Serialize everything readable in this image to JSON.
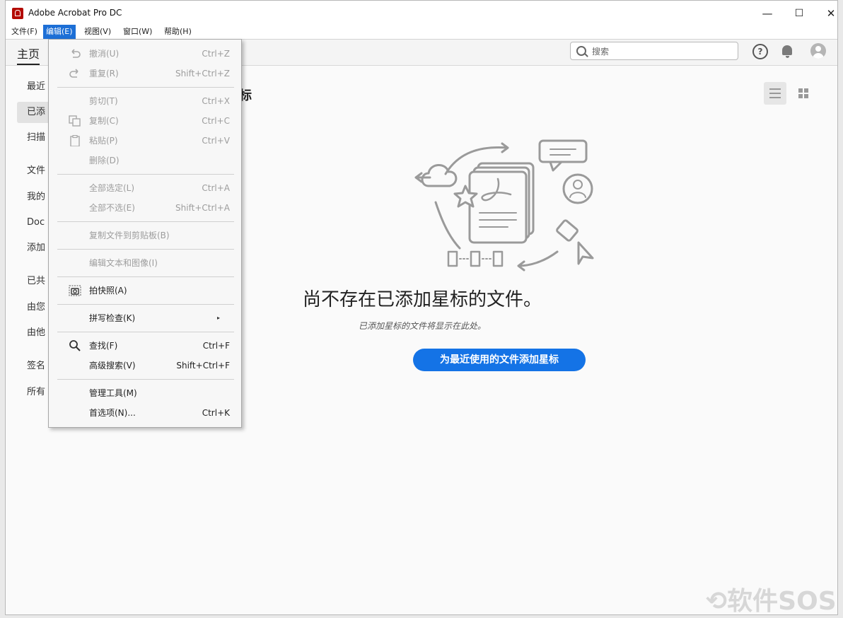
{
  "app": {
    "title": "Adobe Acrobat Pro DC"
  },
  "window_controls": {
    "minimize": "—",
    "maximize": "☐",
    "close": "✕"
  },
  "menubar": [
    {
      "label": "文件(F)"
    },
    {
      "label": "编辑(E)"
    },
    {
      "label": "视图(V)"
    },
    {
      "label": "窗口(W)"
    },
    {
      "label": "帮助(H)"
    }
  ],
  "tabbar": {
    "home_label": "主页",
    "search_placeholder": "搜索",
    "help_glyph": "?"
  },
  "sidebar": {
    "items": [
      {
        "label": "最近"
      },
      {
        "label": "已添"
      },
      {
        "label": "扫描"
      },
      {
        "label": "文件"
      },
      {
        "label": "我的"
      },
      {
        "label": "Doc"
      },
      {
        "label": "添加"
      },
      {
        "label": "已共"
      },
      {
        "label": "由您"
      },
      {
        "label": "由他"
      },
      {
        "label": "签名"
      },
      {
        "label": "所有"
      }
    ]
  },
  "main": {
    "section_title_visible": "标",
    "empty_title": "尚不存在已添加星标的文件。",
    "empty_subtitle": "已添加星标的文件将显示在此处。",
    "cta_label": "为最近使用的文件添加星标"
  },
  "edit_menu": {
    "items": [
      {
        "label": "撤消(U)",
        "shortcut": "Ctrl+Z"
      },
      {
        "label": "重复(R)",
        "shortcut": "Shift+Ctrl+Z"
      },
      {
        "label": "剪切(T)",
        "shortcut": "Ctrl+X"
      },
      {
        "label": "复制(C)",
        "shortcut": "Ctrl+C"
      },
      {
        "label": "粘贴(P)",
        "shortcut": "Ctrl+V"
      },
      {
        "label": "删除(D)",
        "shortcut": ""
      },
      {
        "label": "全部选定(L)",
        "shortcut": "Ctrl+A"
      },
      {
        "label": "全部不选(E)",
        "shortcut": "Shift+Ctrl+A"
      },
      {
        "label": "复制文件到剪贴板(B)",
        "shortcut": ""
      },
      {
        "label": "编辑文本和图像(I)",
        "shortcut": ""
      },
      {
        "label": "拍快照(A)",
        "shortcut": ""
      },
      {
        "label": "拼写检查(K)",
        "shortcut": ""
      },
      {
        "label": "查找(F)",
        "shortcut": "Ctrl+F"
      },
      {
        "label": "高级搜索(V)",
        "shortcut": "Shift+Ctrl+F"
      },
      {
        "label": "管理工具(M)",
        "shortcut": ""
      },
      {
        "label": "首选项(N)...",
        "shortcut": "Ctrl+K"
      }
    ],
    "submenu_arrow": "▸"
  },
  "watermark": "⟲软件SOS"
}
